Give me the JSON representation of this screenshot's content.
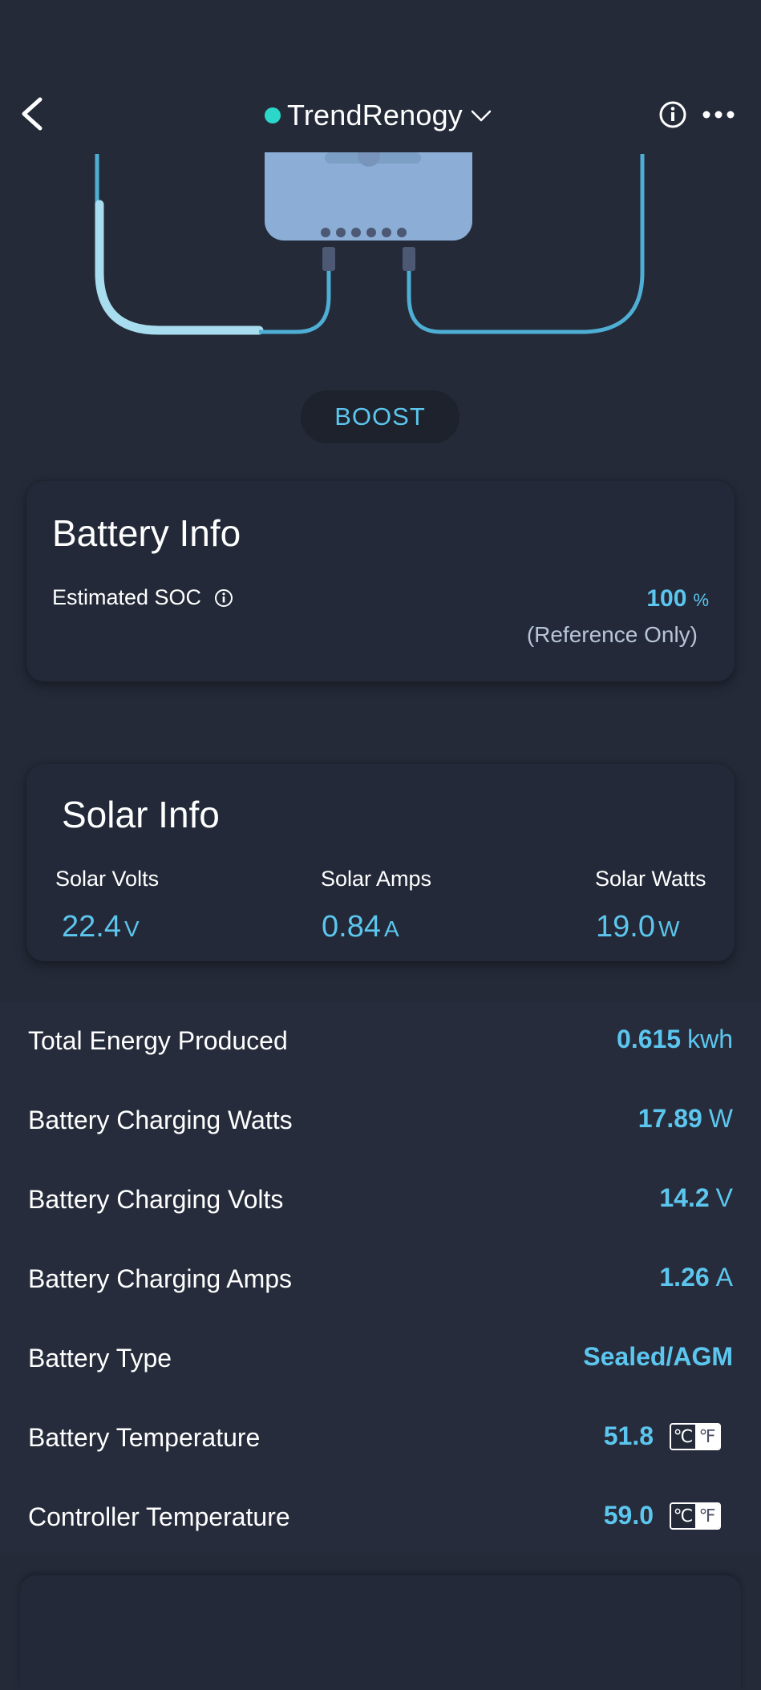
{
  "header": {
    "title": "TrendRenogy",
    "status_color": "#2ad7c9"
  },
  "mode": {
    "label": "BOOST"
  },
  "battery_info": {
    "title": "Battery Info",
    "soc_label": "Estimated SOC",
    "soc_value": "100",
    "soc_unit": "%",
    "reference_note": "(Reference Only)"
  },
  "solar_info": {
    "title": "Solar Info",
    "items": [
      {
        "label": "Solar Volts",
        "value": "22.4",
        "unit": "V"
      },
      {
        "label": "Solar Amps",
        "value": "0.84",
        "unit": "A"
      },
      {
        "label": "Solar Watts",
        "value": "19.0",
        "unit": "W"
      }
    ]
  },
  "metrics": [
    {
      "label": "Total Energy Produced",
      "value": "0.615",
      "unit": "kwh"
    },
    {
      "label": "Battery Charging Watts",
      "value": "17.89",
      "unit": "W"
    },
    {
      "label": "Battery Charging Volts",
      "value": "14.2",
      "unit": "V"
    },
    {
      "label": "Battery Charging Amps",
      "value": "1.26",
      "unit": "A"
    },
    {
      "label": "Battery Type",
      "value": "Sealed/AGM",
      "unit": ""
    },
    {
      "label": "Battery Temperature",
      "value": "51.8",
      "unit": ""
    },
    {
      "label": "Controller Temperature",
      "value": "59.0",
      "unit": ""
    }
  ],
  "temperature_toggle": {
    "celsius": "℃",
    "fahrenheit": "℉",
    "selected": "celsius"
  },
  "colors": {
    "background": "#242a38",
    "accent": "#5cc6ee",
    "card": "#232938"
  },
  "icons": [
    "back-arrow-icon",
    "chevron-down-icon",
    "info-icon",
    "more-icon"
  ]
}
